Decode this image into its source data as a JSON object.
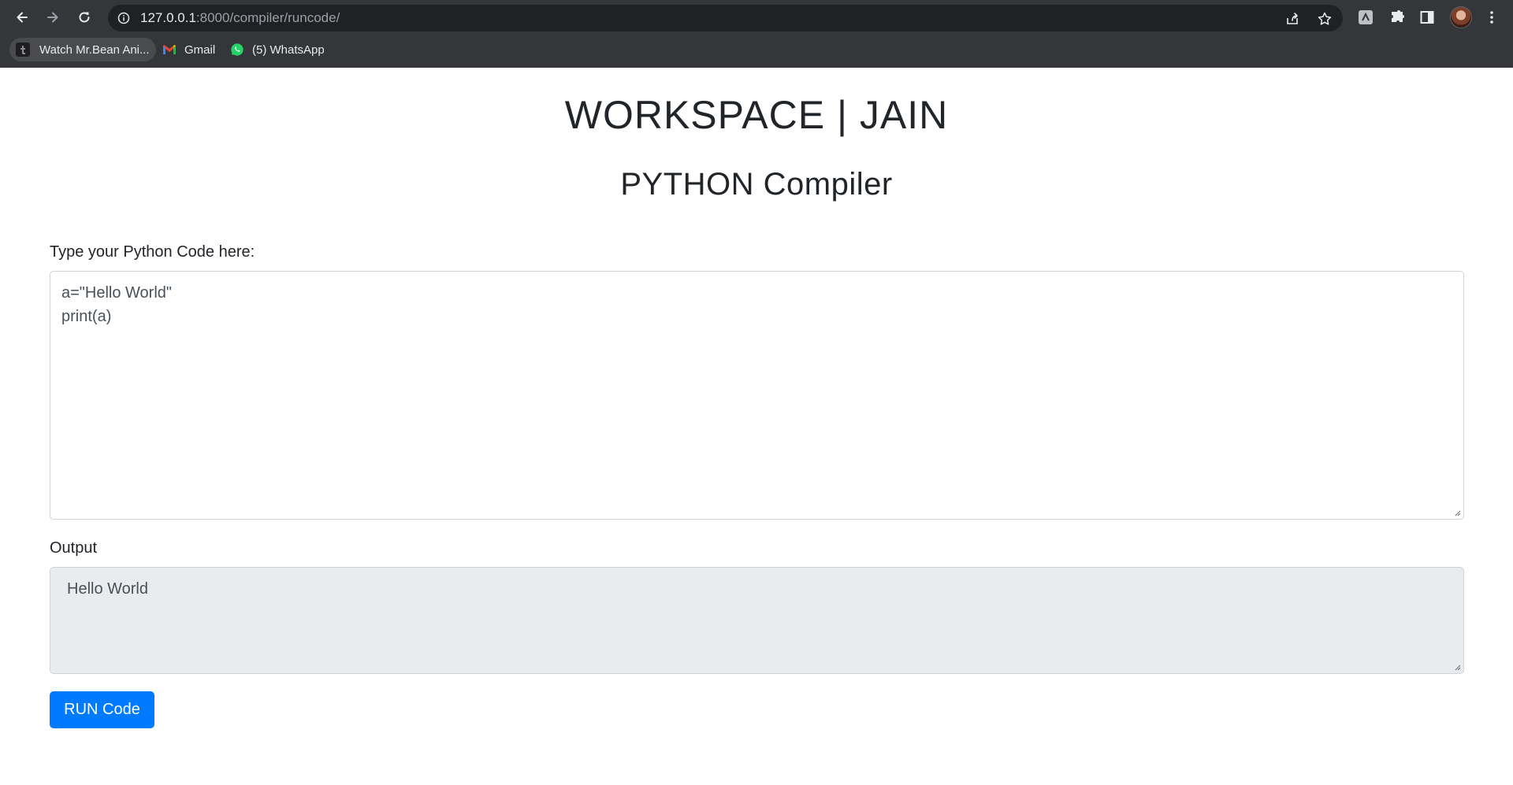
{
  "browser": {
    "url_host": "127.0.0.1",
    "url_path": ":8000/compiler/runcode/",
    "bookmarks": [
      {
        "label": "Watch Mr.Bean Ani...",
        "icon": "tumblr-icon"
      },
      {
        "label": "Gmail",
        "icon": "gmail-icon"
      },
      {
        "label": "(5) WhatsApp",
        "icon": "whatsapp-icon"
      }
    ]
  },
  "page": {
    "title": "WORKSPACE | JAIN",
    "subtitle": "PYTHON Compiler",
    "code_label": "Type your Python Code here:",
    "code_lines": [
      "a=\"Hello World\"",
      "print(a)"
    ],
    "output_label": "Output",
    "output_text": "Hello World",
    "run_button": "RUN Code"
  },
  "colors": {
    "chrome_bg": "#35363a",
    "omnibox_bg": "#202124",
    "button_blue": "#007bff",
    "output_bg": "#e9ecef"
  }
}
